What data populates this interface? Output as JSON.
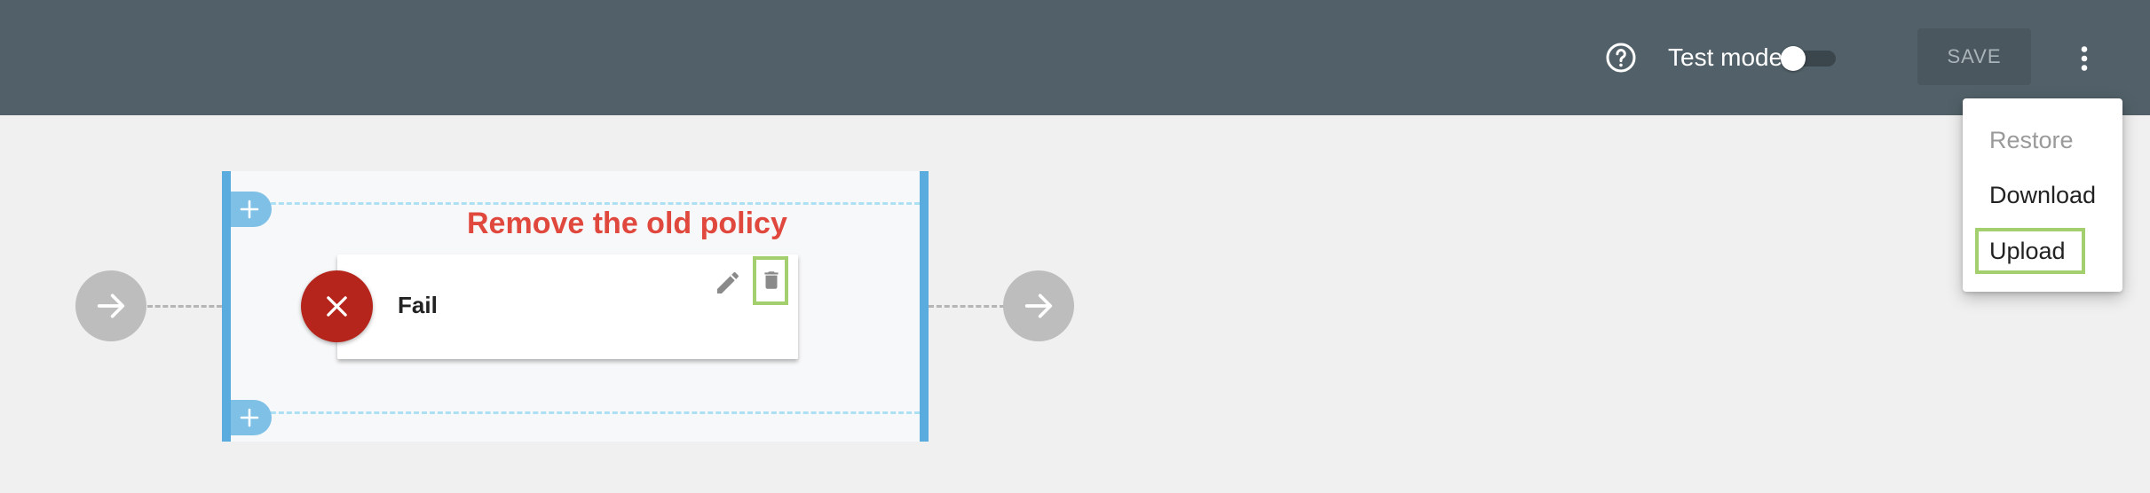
{
  "header": {
    "help_icon": "help-circle-icon",
    "test_mode_label": "Test mode",
    "test_mode_on": false,
    "save_label": "SAVE",
    "more_icon": "more-vertical-icon"
  },
  "menu": {
    "items": [
      {
        "label": "Restore",
        "disabled": true
      },
      {
        "label": "Download",
        "disabled": false
      },
      {
        "label": "Upload",
        "disabled": false,
        "highlighted": true
      }
    ]
  },
  "canvas": {
    "annotation": "Remove the old policy",
    "policy": {
      "title": "Fail",
      "status_icon": "close-icon",
      "edit_icon": "pencil-icon",
      "delete_icon": "trash-icon"
    },
    "add_icon": "plus-icon",
    "flow_icon": "arrow-right-icon"
  },
  "colors": {
    "header_bg": "#526169",
    "annotation": "#e0473d",
    "fail_badge": "#b5251c",
    "highlight": "#a3cf6e",
    "accent_blue": "#5aabde"
  }
}
